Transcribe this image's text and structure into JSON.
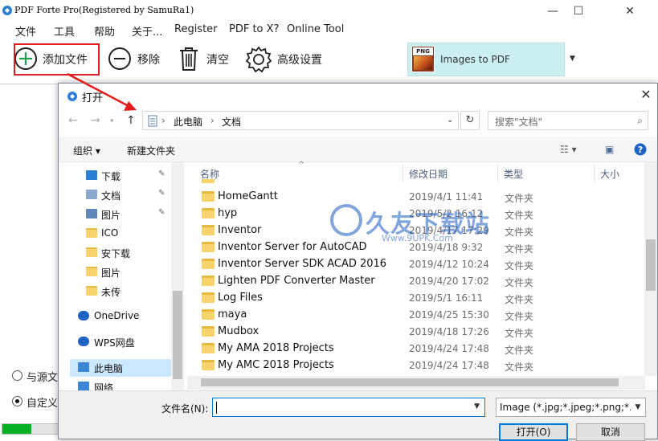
{
  "app": {
    "title": "PDF Forte Pro(Registered by SamuRa1)"
  },
  "window_controls": {
    "minimize": "—",
    "maximize": "☐",
    "close": "✕"
  },
  "menu": [
    "文件",
    "工具",
    "帮助",
    "关于...",
    "Register",
    "PDF to X?",
    "Online Tool"
  ],
  "toolbar": {
    "add_label": "添加文件",
    "remove_label": "移除",
    "clear_label": "清空",
    "settings_label": "高级设置",
    "mode_label": "Images to PDF",
    "mode_icon_tag": "PNG"
  },
  "options": {
    "radio1_label": "与源文",
    "radio2_label": "自定义",
    "radio2_selected": true
  },
  "progress": {
    "fraction": 0.52
  },
  "dialog": {
    "title": "打开",
    "close": "✕",
    "path": [
      "此电脑",
      "文档"
    ],
    "search_placeholder": "搜索\"文档\"",
    "organize_label": "组织 ▾",
    "new_folder_label": "新建文件夹",
    "help_icon": "?",
    "nav_items": [
      {
        "label": "下载",
        "icon": "download-icon",
        "pinned": true
      },
      {
        "label": "文档",
        "icon": "document-icon",
        "pinned": true
      },
      {
        "label": "图片",
        "icon": "picture-icon",
        "pinned": true
      },
      {
        "label": "ICO",
        "icon": "folder-icon",
        "pinned": false
      },
      {
        "label": "安下载",
        "icon": "folder-icon",
        "pinned": false
      },
      {
        "label": "图片",
        "icon": "folder-icon",
        "pinned": false
      },
      {
        "label": "未传",
        "icon": "folder-icon",
        "pinned": false
      },
      {
        "label": "OneDrive",
        "icon": "cloud-icon",
        "pinned": false
      },
      {
        "label": "WPS网盘",
        "icon": "cloud-icon",
        "pinned": false
      },
      {
        "label": "此电脑",
        "icon": "computer-icon",
        "pinned": false,
        "selected": true
      },
      {
        "label": "网络",
        "icon": "network-icon",
        "pinned": false
      }
    ],
    "columns": {
      "name": "名称",
      "date": "修改日期",
      "type": "类型",
      "size": "大小"
    },
    "files": [
      {
        "name": "HomeGantt",
        "date": "2019/4/1 11:41",
        "type": "文件夹"
      },
      {
        "name": "hyp",
        "date": "2019/5/2 16:12",
        "type": "文件夹"
      },
      {
        "name": "Inventor",
        "date": "2019/4/17 17:29",
        "type": "文件夹"
      },
      {
        "name": "Inventor Server for AutoCAD",
        "date": "2019/4/18 9:32",
        "type": "文件夹"
      },
      {
        "name": "Inventor Server SDK ACAD 2016",
        "date": "2019/4/12 10:24",
        "type": "文件夹"
      },
      {
        "name": "Lighten PDF Converter Master",
        "date": "2019/4/20 17:02",
        "type": "文件夹"
      },
      {
        "name": "Log Files",
        "date": "2019/5/1 16:11",
        "type": "文件夹"
      },
      {
        "name": "maya",
        "date": "2019/4/25 15:30",
        "type": "文件夹"
      },
      {
        "name": "Mudbox",
        "date": "2019/4/18 17:26",
        "type": "文件夹"
      },
      {
        "name": "My AMA 2018 Projects",
        "date": "2019/4/24 17:48",
        "type": "文件夹"
      },
      {
        "name": "My AMC 2018 Projects",
        "date": "2019/4/24 17:48",
        "type": "文件夹"
      }
    ],
    "filename_label": "文件名(N):",
    "filename_value": "",
    "filter_label": "Image (*.jpg;*.jpeg;*.png;*.bmp)",
    "open_label": "打开(O)",
    "cancel_label": "取消"
  },
  "watermark": {
    "text": "久友下载站",
    "url": "Www.9UPK.Com"
  },
  "colors": {
    "highlight": "#e21c1c",
    "accent": "#0078d7",
    "combo_bg": "#cbeef0",
    "progress": "#06b025"
  }
}
